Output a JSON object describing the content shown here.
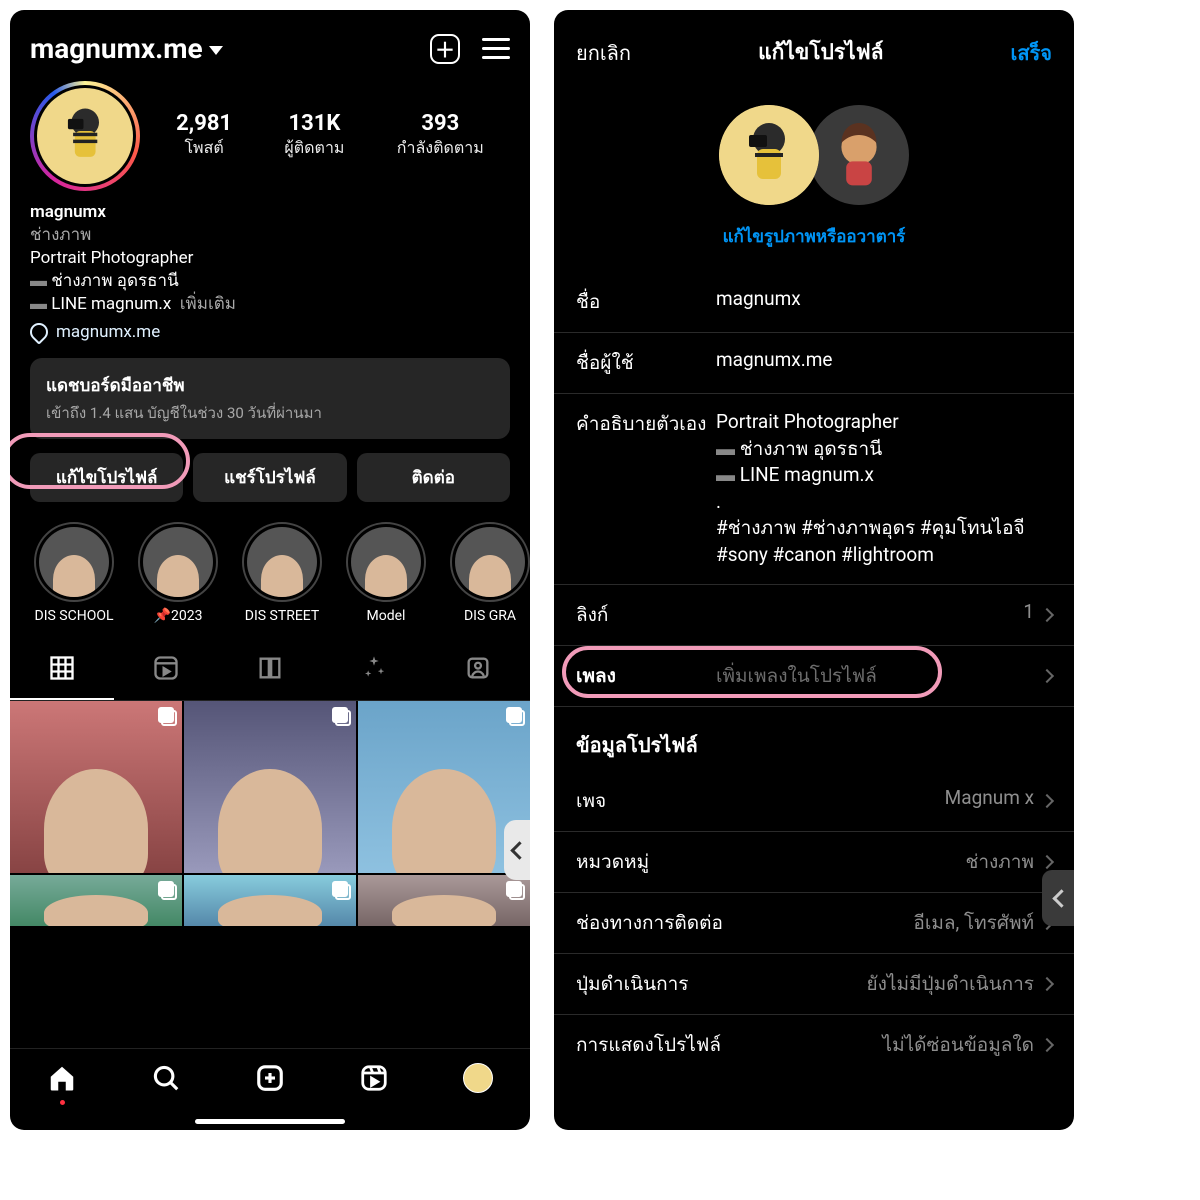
{
  "left": {
    "username": "magnumx.me",
    "stats": {
      "posts": {
        "num": "2,981",
        "label": "โพสต์"
      },
      "followers": {
        "num": "131K",
        "label": "ผู้ติดตาม"
      },
      "following": {
        "num": "393",
        "label": "กำลังติดตาม"
      }
    },
    "bio": {
      "name": "magnumx",
      "category": "ช่างภาพ",
      "line1": "Portrait Photographer",
      "line2": "ช่างภาพ อุดรธานี",
      "line3": "LINE magnum.x",
      "more": "เพิ่มเติม"
    },
    "link": "magnumx.me",
    "dashboard": {
      "title": "แดชบอร์ดมืออาชีพ",
      "sub": "เข้าถึง 1.4 แสน บัญชีในช่วง 30 วันที่ผ่านมา"
    },
    "buttons": {
      "edit": "แก้ไขโปรไฟล์",
      "share": "แชร์โปรไฟล์",
      "contact": "ติดต่อ"
    },
    "highlights": [
      {
        "label": "DIS SCHOOL"
      },
      {
        "label": "📌2023"
      },
      {
        "label": "DIS STREET"
      },
      {
        "label": "Model"
      },
      {
        "label": "DIS GRA"
      }
    ]
  },
  "right": {
    "header": {
      "cancel": "ยกเลิก",
      "title": "แก้ไขโปรไฟล์",
      "done": "เสร็จ"
    },
    "editPhoto": "แก้ไขรูปภาพหรืออวาตาร์",
    "fields": {
      "name": {
        "label": "ชื่อ",
        "value": "magnumx"
      },
      "username": {
        "label": "ชื่อผู้ใช้",
        "value": "magnumx.me"
      },
      "bio": {
        "label": "คำอธิบายตัวเอง",
        "l1": "Portrait Photographer",
        "l2": "ช่างภาพ อุดรธานี",
        "l3": "LINE magnum.x",
        "l4": ".",
        "l5": "#ช่างภาพ #ช่างภาพอุดร #คุมโทนไอจี #sony #canon #lightroom"
      },
      "link": {
        "label": "ลิงก์",
        "value": "1"
      },
      "music": {
        "label": "เพลง",
        "placeholder": "เพิ่มเพลงในโปรไฟล์"
      }
    },
    "section": "ข้อมูลโปรไฟล์",
    "rows": {
      "page": {
        "label": "เพจ",
        "value": "Magnum x"
      },
      "category": {
        "label": "หมวดหมู่",
        "value": "ช่างภาพ"
      },
      "contact": {
        "label": "ช่องทางการติดต่อ",
        "value": "อีเมล, โทรศัพท์"
      },
      "action": {
        "label": "ปุ่มดำเนินการ",
        "value": "ยังไม่มีปุ่มดำเนินการ"
      },
      "display": {
        "label": "การแสดงโปรไฟล์",
        "value": "ไม่ได้ซ่อนข้อมูลใด"
      }
    }
  }
}
